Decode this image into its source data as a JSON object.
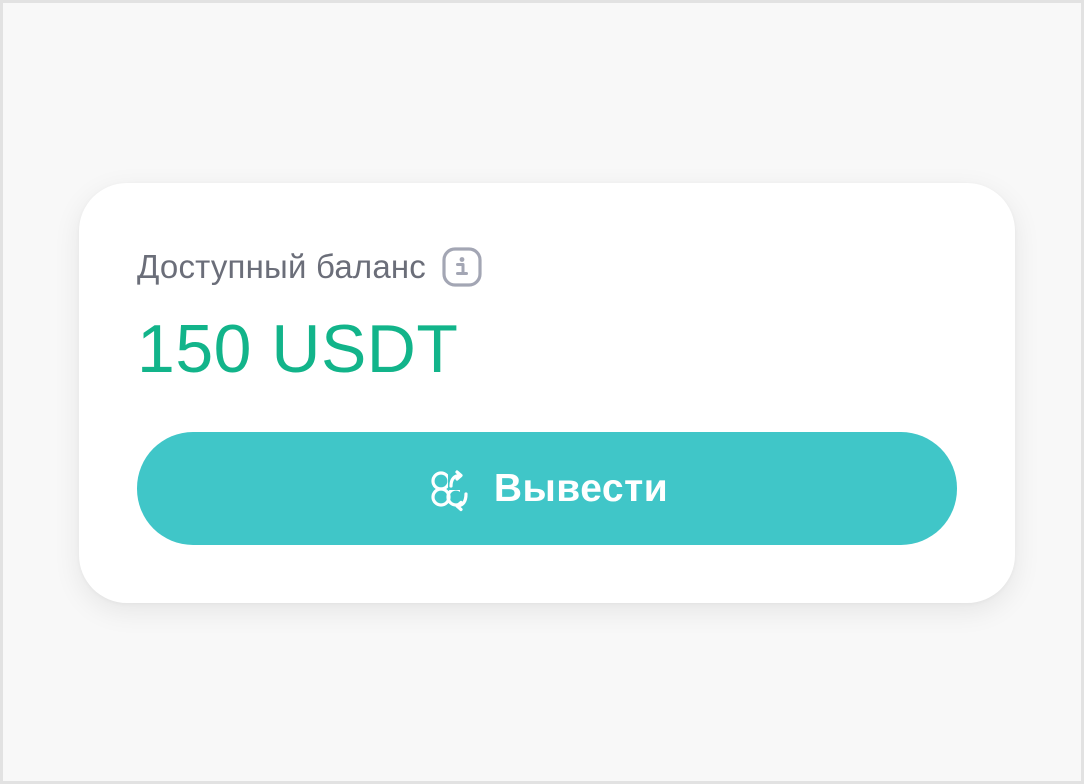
{
  "balance_card": {
    "label": "Доступный баланс",
    "info_icon": "info-icon",
    "amount": "150 USDT",
    "withdraw_button": {
      "label": "Вывести",
      "icon": "exchange-icon"
    }
  },
  "colors": {
    "amount": "#12b48a",
    "button_background": "#40c6c8",
    "label": "#6b6e79",
    "info_icon": "#a3a6b4",
    "page_background": "#f8f8f8",
    "card_background": "#ffffff"
  }
}
